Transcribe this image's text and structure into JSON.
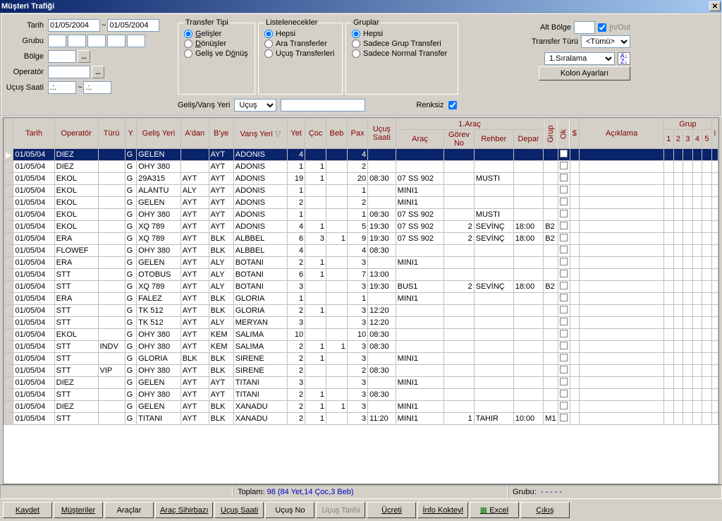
{
  "window": {
    "title": "Müşteri Trafiği"
  },
  "filters": {
    "tarih_label": "Tarih",
    "tarih_from": "01/05/2004",
    "tarih_to": "01/05/2004",
    "tilde": "~",
    "grubu_label": "Grubu",
    "bolge_label": "Bölge",
    "operator_label": "Operatör",
    "ucus_saati_label": "Uçuş Saati",
    "time_from": ".:.",
    "time_to": ".:."
  },
  "transfer_tipi": {
    "legend": "Transfer Tipi",
    "options": [
      "Gelişler",
      "Dönüşler",
      "Geliş ve Dönüş"
    ],
    "selected": 0,
    "underline": [
      0,
      0,
      9
    ]
  },
  "listelenecekler": {
    "legend": "Listelenecekler",
    "options": [
      "Hepsi",
      "Ara Transferler",
      "Uçuş Transferleri"
    ],
    "selected": 0
  },
  "gruplar": {
    "legend": "Gruplar",
    "options": [
      "Hepsi",
      "Sadece Grup Transferi",
      "Sadece Normal Transfer"
    ],
    "selected": 0
  },
  "right": {
    "alt_bolge_label": "Alt Bölge",
    "inout_label": "In/Out",
    "transfer_turu_label": "Transfer Türü",
    "transfer_turu_value": "<Tümü>",
    "siralama_value": "1.Sıralama",
    "kolon_ayarlari": "Kolon Ayarları"
  },
  "mid": {
    "gelis_varis_label": "Geliş/Varış Yeri",
    "gelis_varis_value": "Uçuş",
    "renksiz_label": "Renksiz",
    "renksiz_checked": true
  },
  "columns": {
    "tarih": "Tarih",
    "operator": "Operatör",
    "turu": "Türü",
    "y": "Y",
    "gelis_yeri": "Geliş Yeri",
    "adan": "A'dan",
    "bye": "B'ye",
    "varis_yeri": "Varış Yeri",
    "yet": "Yet",
    "coc": "Çoc",
    "beb": "Beb",
    "pax": "Pax",
    "ucus_saati": "Uçuş\nSaati",
    "arac_group": "1.Araç",
    "arac": "Araç",
    "gorev_no": "Görev\nNo",
    "rehber": "Rehber",
    "depar": "Depar",
    "grup": "Grup",
    "ok": "Ok",
    "dolar": "$",
    "aciklama": "Açıklama",
    "grup_group": "Grup",
    "g1": "1",
    "g2": "2",
    "g3": "3",
    "g4": "4",
    "g5": "5",
    "i": "i"
  },
  "rows": [
    {
      "tarih": "01/05/04",
      "op": "DIEZ",
      "turu": "",
      "y": "G",
      "gelis": "GELEN",
      "adan": "",
      "bye": "AYT",
      "varis": "ADONIS",
      "yet": 4,
      "coc": "",
      "beb": "",
      "pax": 4,
      "usaat": "",
      "arac": "",
      "gorev": "",
      "rehber": "",
      "depar": "",
      "bg": ""
    },
    {
      "tarih": "01/05/04",
      "op": "DIEZ",
      "turu": "",
      "y": "G",
      "gelis": "OHY 380",
      "adan": "",
      "bye": "AYT",
      "varis": "ADONIS",
      "yet": 1,
      "coc": 1,
      "beb": "",
      "pax": 2,
      "usaat": "",
      "arac": "",
      "gorev": "",
      "rehber": "",
      "depar": "",
      "bg": ""
    },
    {
      "tarih": "01/05/04",
      "op": "EKOL",
      "turu": "",
      "y": "G",
      "gelis": "29A315",
      "adan": "AYT",
      "bye": "AYT",
      "varis": "ADONIS",
      "yet": 19,
      "coc": 1,
      "beb": "",
      "pax": 20,
      "usaat": "08:30",
      "arac": "07 SS 902",
      "gorev": "",
      "rehber": "MUSTI",
      "depar": "",
      "bg": ""
    },
    {
      "tarih": "01/05/04",
      "op": "EKOL",
      "turu": "",
      "y": "G",
      "gelis": "ALANTU",
      "adan": "ALY",
      "bye": "AYT",
      "varis": "ADONIS",
      "yet": 1,
      "coc": "",
      "beb": "",
      "pax": 1,
      "usaat": "",
      "arac": "MINI1",
      "gorev": "",
      "rehber": "",
      "depar": "",
      "bg": ""
    },
    {
      "tarih": "01/05/04",
      "op": "EKOL",
      "turu": "",
      "y": "G",
      "gelis": "GELEN",
      "adan": "AYT",
      "bye": "AYT",
      "varis": "ADONIS",
      "yet": 2,
      "coc": "",
      "beb": "",
      "pax": 2,
      "usaat": "",
      "arac": "MINI1",
      "gorev": "",
      "rehber": "",
      "depar": "",
      "bg": ""
    },
    {
      "tarih": "01/05/04",
      "op": "EKOL",
      "turu": "",
      "y": "G",
      "gelis": "OHY 380",
      "adan": "AYT",
      "bye": "AYT",
      "varis": "ADONIS",
      "yet": 1,
      "coc": "",
      "beb": "",
      "pax": 1,
      "usaat": "08:30",
      "arac": "07 SS 902",
      "gorev": "",
      "rehber": "MUSTI",
      "depar": "",
      "bg": ""
    },
    {
      "tarih": "01/05/04",
      "op": "EKOL",
      "turu": "",
      "y": "G",
      "gelis": "XQ 789",
      "adan": "AYT",
      "bye": "AYT",
      "varis": "ADONIS",
      "yet": 4,
      "coc": 1,
      "beb": "",
      "pax": 5,
      "usaat": "19:30",
      "arac": "07 SS 902",
      "gorev": 2,
      "rehber": "SEVİNÇ",
      "depar": "18:00",
      "bg": "B2"
    },
    {
      "tarih": "01/05/04",
      "op": "ERA",
      "turu": "",
      "y": "G",
      "gelis": "XQ 789",
      "adan": "AYT",
      "bye": "BLK",
      "varis": "ALBBEL",
      "yet": 6,
      "coc": 3,
      "beb": 1,
      "pax": 9,
      "usaat": "19:30",
      "arac": "07 SS 902",
      "gorev": 2,
      "rehber": "SEVİNÇ",
      "depar": "18:00",
      "bg": "B2"
    },
    {
      "tarih": "01/05/04",
      "op": "FLOWEF",
      "turu": "",
      "y": "G",
      "gelis": "OHY 380",
      "adan": "AYT",
      "bye": "BLK",
      "varis": "ALBBEL",
      "yet": 4,
      "coc": "",
      "beb": "",
      "pax": 4,
      "usaat": "08:30",
      "arac": "",
      "gorev": "",
      "rehber": "",
      "depar": "",
      "bg": ""
    },
    {
      "tarih": "01/05/04",
      "op": "ERA",
      "turu": "",
      "y": "G",
      "gelis": "GELEN",
      "adan": "AYT",
      "bye": "ALY",
      "varis": "BOTANI",
      "yet": 2,
      "coc": 1,
      "beb": "",
      "pax": 3,
      "usaat": "",
      "arac": "MINI1",
      "gorev": "",
      "rehber": "",
      "depar": "",
      "bg": ""
    },
    {
      "tarih": "01/05/04",
      "op": "STT",
      "turu": "",
      "y": "G",
      "gelis": "OTOBUS",
      "adan": "AYT",
      "bye": "ALY",
      "varis": "BOTANI",
      "yet": 6,
      "coc": 1,
      "beb": "",
      "pax": 7,
      "usaat": "13:00",
      "arac": "",
      "gorev": "",
      "rehber": "",
      "depar": "",
      "bg": ""
    },
    {
      "tarih": "01/05/04",
      "op": "STT",
      "turu": "",
      "y": "G",
      "gelis": "XQ 789",
      "adan": "AYT",
      "bye": "ALY",
      "varis": "BOTANI",
      "yet": 3,
      "coc": "",
      "beb": "",
      "pax": 3,
      "usaat": "19:30",
      "arac": "BUS1",
      "gorev": 2,
      "rehber": "SEVİNÇ",
      "depar": "18:00",
      "bg": "B2"
    },
    {
      "tarih": "01/05/04",
      "op": "ERA",
      "turu": "",
      "y": "G",
      "gelis": "FALEZ",
      "adan": "AYT",
      "bye": "BLK",
      "varis": "GLORIA",
      "yet": 1,
      "coc": "",
      "beb": "",
      "pax": 1,
      "usaat": "",
      "arac": "MINI1",
      "gorev": "",
      "rehber": "",
      "depar": "",
      "bg": ""
    },
    {
      "tarih": "01/05/04",
      "op": "STT",
      "turu": "",
      "y": "G",
      "gelis": "TK 512",
      "adan": "AYT",
      "bye": "BLK",
      "varis": "GLORIA",
      "yet": 2,
      "coc": 1,
      "beb": "",
      "pax": 3,
      "usaat": "12:20",
      "arac": "",
      "gorev": "",
      "rehber": "",
      "depar": "",
      "bg": ""
    },
    {
      "tarih": "01/05/04",
      "op": "STT",
      "turu": "",
      "y": "G",
      "gelis": "TK 512",
      "adan": "AYT",
      "bye": "ALY",
      "varis": "MERYAN",
      "yet": 3,
      "coc": "",
      "beb": "",
      "pax": 3,
      "usaat": "12:20",
      "arac": "",
      "gorev": "",
      "rehber": "",
      "depar": "",
      "bg": ""
    },
    {
      "tarih": "01/05/04",
      "op": "EKOL",
      "turu": "",
      "y": "G",
      "gelis": "OHY 380",
      "adan": "AYT",
      "bye": "KEM",
      "varis": "SALIMA",
      "yet": 10,
      "coc": "",
      "beb": "",
      "pax": 10,
      "usaat": "08:30",
      "arac": "",
      "gorev": "",
      "rehber": "",
      "depar": "",
      "bg": ""
    },
    {
      "tarih": "01/05/04",
      "op": "STT",
      "turu": "INDV",
      "y": "G",
      "gelis": "OHY 380",
      "adan": "AYT",
      "bye": "KEM",
      "varis": "SALIMA",
      "yet": 2,
      "coc": 1,
      "beb": 1,
      "pax": 3,
      "usaat": "08:30",
      "arac": "",
      "gorev": "",
      "rehber": "",
      "depar": "",
      "bg": ""
    },
    {
      "tarih": "01/05/04",
      "op": "STT",
      "turu": "",
      "y": "G",
      "gelis": "GLORIA",
      "adan": "BLK",
      "bye": "BLK",
      "varis": "SIRENE",
      "yet": 2,
      "coc": 1,
      "beb": "",
      "pax": 3,
      "usaat": "",
      "arac": "MINI1",
      "gorev": "",
      "rehber": "",
      "depar": "",
      "bg": ""
    },
    {
      "tarih": "01/05/04",
      "op": "STT",
      "turu": "VIP",
      "y": "G",
      "gelis": "OHY 380",
      "adan": "AYT",
      "bye": "BLK",
      "varis": "SIRENE",
      "yet": 2,
      "coc": "",
      "beb": "",
      "pax": 2,
      "usaat": "08:30",
      "arac": "",
      "gorev": "",
      "rehber": "",
      "depar": "",
      "bg": ""
    },
    {
      "tarih": "01/05/04",
      "op": "DIEZ",
      "turu": "",
      "y": "G",
      "gelis": "GELEN",
      "adan": "AYT",
      "bye": "AYT",
      "varis": "TITANI",
      "yet": 3,
      "coc": "",
      "beb": "",
      "pax": 3,
      "usaat": "",
      "arac": "MINI1",
      "gorev": "",
      "rehber": "",
      "depar": "",
      "bg": ""
    },
    {
      "tarih": "01/05/04",
      "op": "STT",
      "turu": "",
      "y": "G",
      "gelis": "OHY 380",
      "adan": "AYT",
      "bye": "AYT",
      "varis": "TITANI",
      "yet": 2,
      "coc": 1,
      "beb": "",
      "pax": 3,
      "usaat": "08:30",
      "arac": "",
      "gorev": "",
      "rehber": "",
      "depar": "",
      "bg": ""
    },
    {
      "tarih": "01/05/04",
      "op": "DIEZ",
      "turu": "",
      "y": "G",
      "gelis": "GELEN",
      "adan": "AYT",
      "bye": "BLK",
      "varis": "XANADU",
      "yet": 2,
      "coc": 1,
      "beb": 1,
      "pax": 3,
      "usaat": "",
      "arac": "MINI1",
      "gorev": "",
      "rehber": "",
      "depar": "",
      "bg": ""
    },
    {
      "tarih": "01/05/04",
      "op": "STT",
      "turu": "",
      "y": "G",
      "gelis": "TITANI",
      "adan": "AYT",
      "bye": "BLK",
      "varis": "XANADU",
      "yet": 2,
      "coc": 1,
      "beb": "",
      "pax": 3,
      "usaat": "11:20",
      "arac": "MINI1",
      "gorev": 1,
      "rehber": "TAHIR",
      "depar": "10:00",
      "bg": "M1"
    }
  ],
  "status": {
    "toplam_label": "Toplam:",
    "toplam_value": "98 (84 Yet,14 Çoc,3 Beb)",
    "grubu_label": "Grubu:",
    "grubu_value": "-    -    -    -    -"
  },
  "buttons": {
    "kaydet": "Kaydet",
    "musteriler": "Müşteriler",
    "araclar": "Araçlar",
    "arac_sihirbazi": "Araç Sihirbazı",
    "ucus_saati": "Uçuş Saati",
    "ucus_no": "Uçuş No",
    "ucus_tarihi": "Uçuş Tarihi",
    "ucreti": "Ücreti",
    "info_kokteyl": "İnfo Kokteyl",
    "excel": "Excel",
    "cikis": "Çıkış"
  }
}
